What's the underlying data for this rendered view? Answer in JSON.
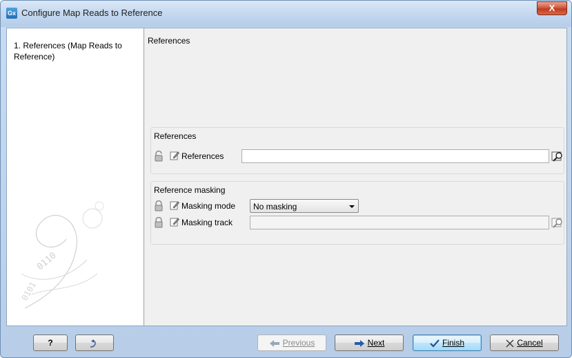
{
  "window": {
    "title": "Configure Map Reads to Reference",
    "app_icon": "Gx",
    "close_label": "X"
  },
  "steps": [
    {
      "number": "1.",
      "label": "References (Map Reads to Reference)"
    }
  ],
  "page": {
    "heading": "References"
  },
  "references_group": {
    "title": "References",
    "references_label": "References",
    "references_value": ""
  },
  "masking_group": {
    "title": "Reference masking",
    "mode_label": "Masking mode",
    "mode_value": "No masking",
    "track_label": "Masking track",
    "track_value": ""
  },
  "buttons": {
    "help": "?",
    "previous": "Previous",
    "next": "Next",
    "finish": "Finish",
    "cancel": "Cancel"
  },
  "icons": {
    "lock": "lock-icon",
    "edit": "pencil-icon",
    "browse": "browse-icon",
    "reset": "reset-icon"
  }
}
